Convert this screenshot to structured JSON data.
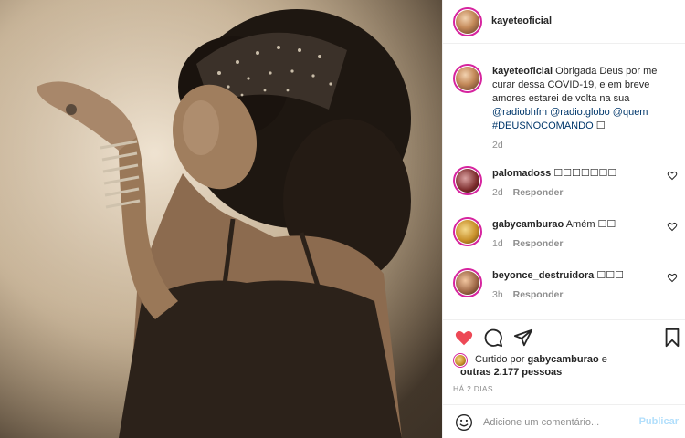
{
  "post": {
    "image_alt": "Foto em tons sépia de mulher com cabelo volumoso e tiara brilhante soprando um beijo"
  },
  "header": {
    "username": "kayeteoficial"
  },
  "caption": {
    "username": "kayeteoficial",
    "text": "Obrigada Deus por me curar dessa COVID-19, e em breve amores estarei de volta na sua",
    "mentions": "@radiobhfm @radio.globo @quem",
    "hashtag": "#DEUSNOCOMANDO",
    "trailing_emoji": "☐",
    "time": "2d"
  },
  "comments": [
    {
      "username": "palomadoss",
      "text": "☐☐☐☐☐☐☐",
      "time": "2d",
      "reply": "Responder"
    },
    {
      "username": "gabycamburao",
      "text": "Amém ☐☐",
      "time": "1d",
      "reply": "Responder"
    },
    {
      "username": "beyonce_destruidora",
      "text": "☐☐☐",
      "time": "3h",
      "reply": "Responder"
    }
  ],
  "likes": {
    "prefix": "Curtido por",
    "user": "gabycamburao",
    "joiner": "e",
    "others": "outras 2.177 pessoas"
  },
  "timestamp": "HÁ 2 DIAS",
  "add_comment": {
    "placeholder": "Adicione um comentário...",
    "post_label": "Publicar"
  },
  "colors": {
    "like_red": "#ed4956",
    "link_blue": "#00376b",
    "post_disabled": "#b2dffc",
    "muted_gray": "#8e8e8e"
  },
  "icons": [
    "heart-filled-icon",
    "comment-icon",
    "share-icon",
    "bookmark-icon",
    "smile-icon",
    "heart-outline-icon"
  ]
}
